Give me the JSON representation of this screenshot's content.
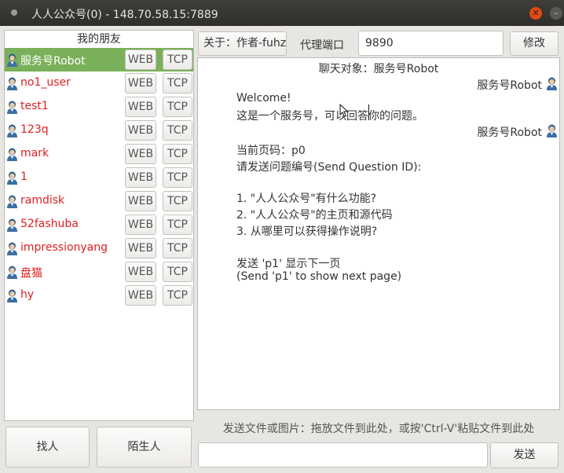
{
  "window": {
    "title": "人人公众号(0) - 148.70.58.15:7889"
  },
  "friends": {
    "header": "我的朋友",
    "web_label": "WEB",
    "tcp_label": "TCP",
    "items": [
      {
        "name": "服务号Robot",
        "selected": true
      },
      {
        "name": "no1_user"
      },
      {
        "name": "test1"
      },
      {
        "name": "123q"
      },
      {
        "name": "mark"
      },
      {
        "name": "1"
      },
      {
        "name": "ramdisk"
      },
      {
        "name": "52fashuba"
      },
      {
        "name": "impressionyang"
      },
      {
        "name": "盘猫"
      },
      {
        "name": "hy"
      }
    ]
  },
  "left_buttons": {
    "find": "找人",
    "strangers": "陌生人"
  },
  "toolbar": {
    "about": "关于：作者-fuhz",
    "proxy_label": "代理端口",
    "proxy_value": "9890",
    "modify": "修改"
  },
  "chat": {
    "target": "聊天对象：服务号Robot",
    "sender": "服务号Robot",
    "messages": [
      [
        "Welcome!",
        "这是一个服务号，可以回答你的问题。"
      ],
      [
        "当前页码：p0",
        "请发送问题编号(Send Question ID):",
        "",
        "1. \"人人公众号\"有什么功能?",
        "2. \"人人公众号\"的主页和源代码",
        "3. 从哪里可以获得操作说明?",
        "",
        "发送 'p1' 显示下一页",
        "(Send 'p1' to show next page)"
      ]
    ]
  },
  "send": {
    "hint": "发送文件或图片：拖放文件到此处，或按'Ctrl-V'粘贴文件到此处",
    "input_value": "",
    "button": "发送"
  },
  "colors": {
    "selected_row": "#7ab05a",
    "friend_name": "#e02020",
    "close_button": "#df4a16"
  },
  "icons": [
    "user-avatar-icon",
    "close-icon",
    "minimize-icon",
    "mouse-pointer-icon"
  ]
}
